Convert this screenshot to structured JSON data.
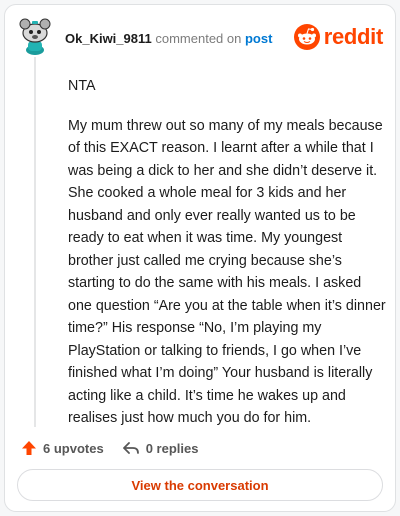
{
  "comment": {
    "username": "Ok_Kiwi_9811",
    "action": "commented on",
    "target": "post",
    "paragraphs": [
      "NTA",
      "My mum threw out so many of my meals because of this EXACT reason. I learnt after a while that I was being a dick to her and she didn’t deserve it. She cooked a whole meal for 3 kids and her husband and only ever really wanted us to be ready to eat when it was time. My youngest brother just called me crying because she’s starting to do the same with his meals. I asked one question “Are you at the table when it’s dinner time?” His response “No, I’m playing my PlayStation or talking to friends, I go when I’ve finished what I’m doing” Your husband is literally acting like a child. It’s time he wakes up and realises just how much you do for him."
    ]
  },
  "brand": {
    "logo_text": "reddit",
    "color": "#ff4500"
  },
  "footer": {
    "upvotes": "6 upvotes",
    "replies": "0 replies"
  },
  "cta": {
    "label": "View the conversation"
  },
  "icons": {
    "avatar": "snoo-avatar-icon",
    "logo": "reddit-logo-icon",
    "upvote": "upvote-arrow-icon",
    "reply": "reply-arrow-icon"
  }
}
